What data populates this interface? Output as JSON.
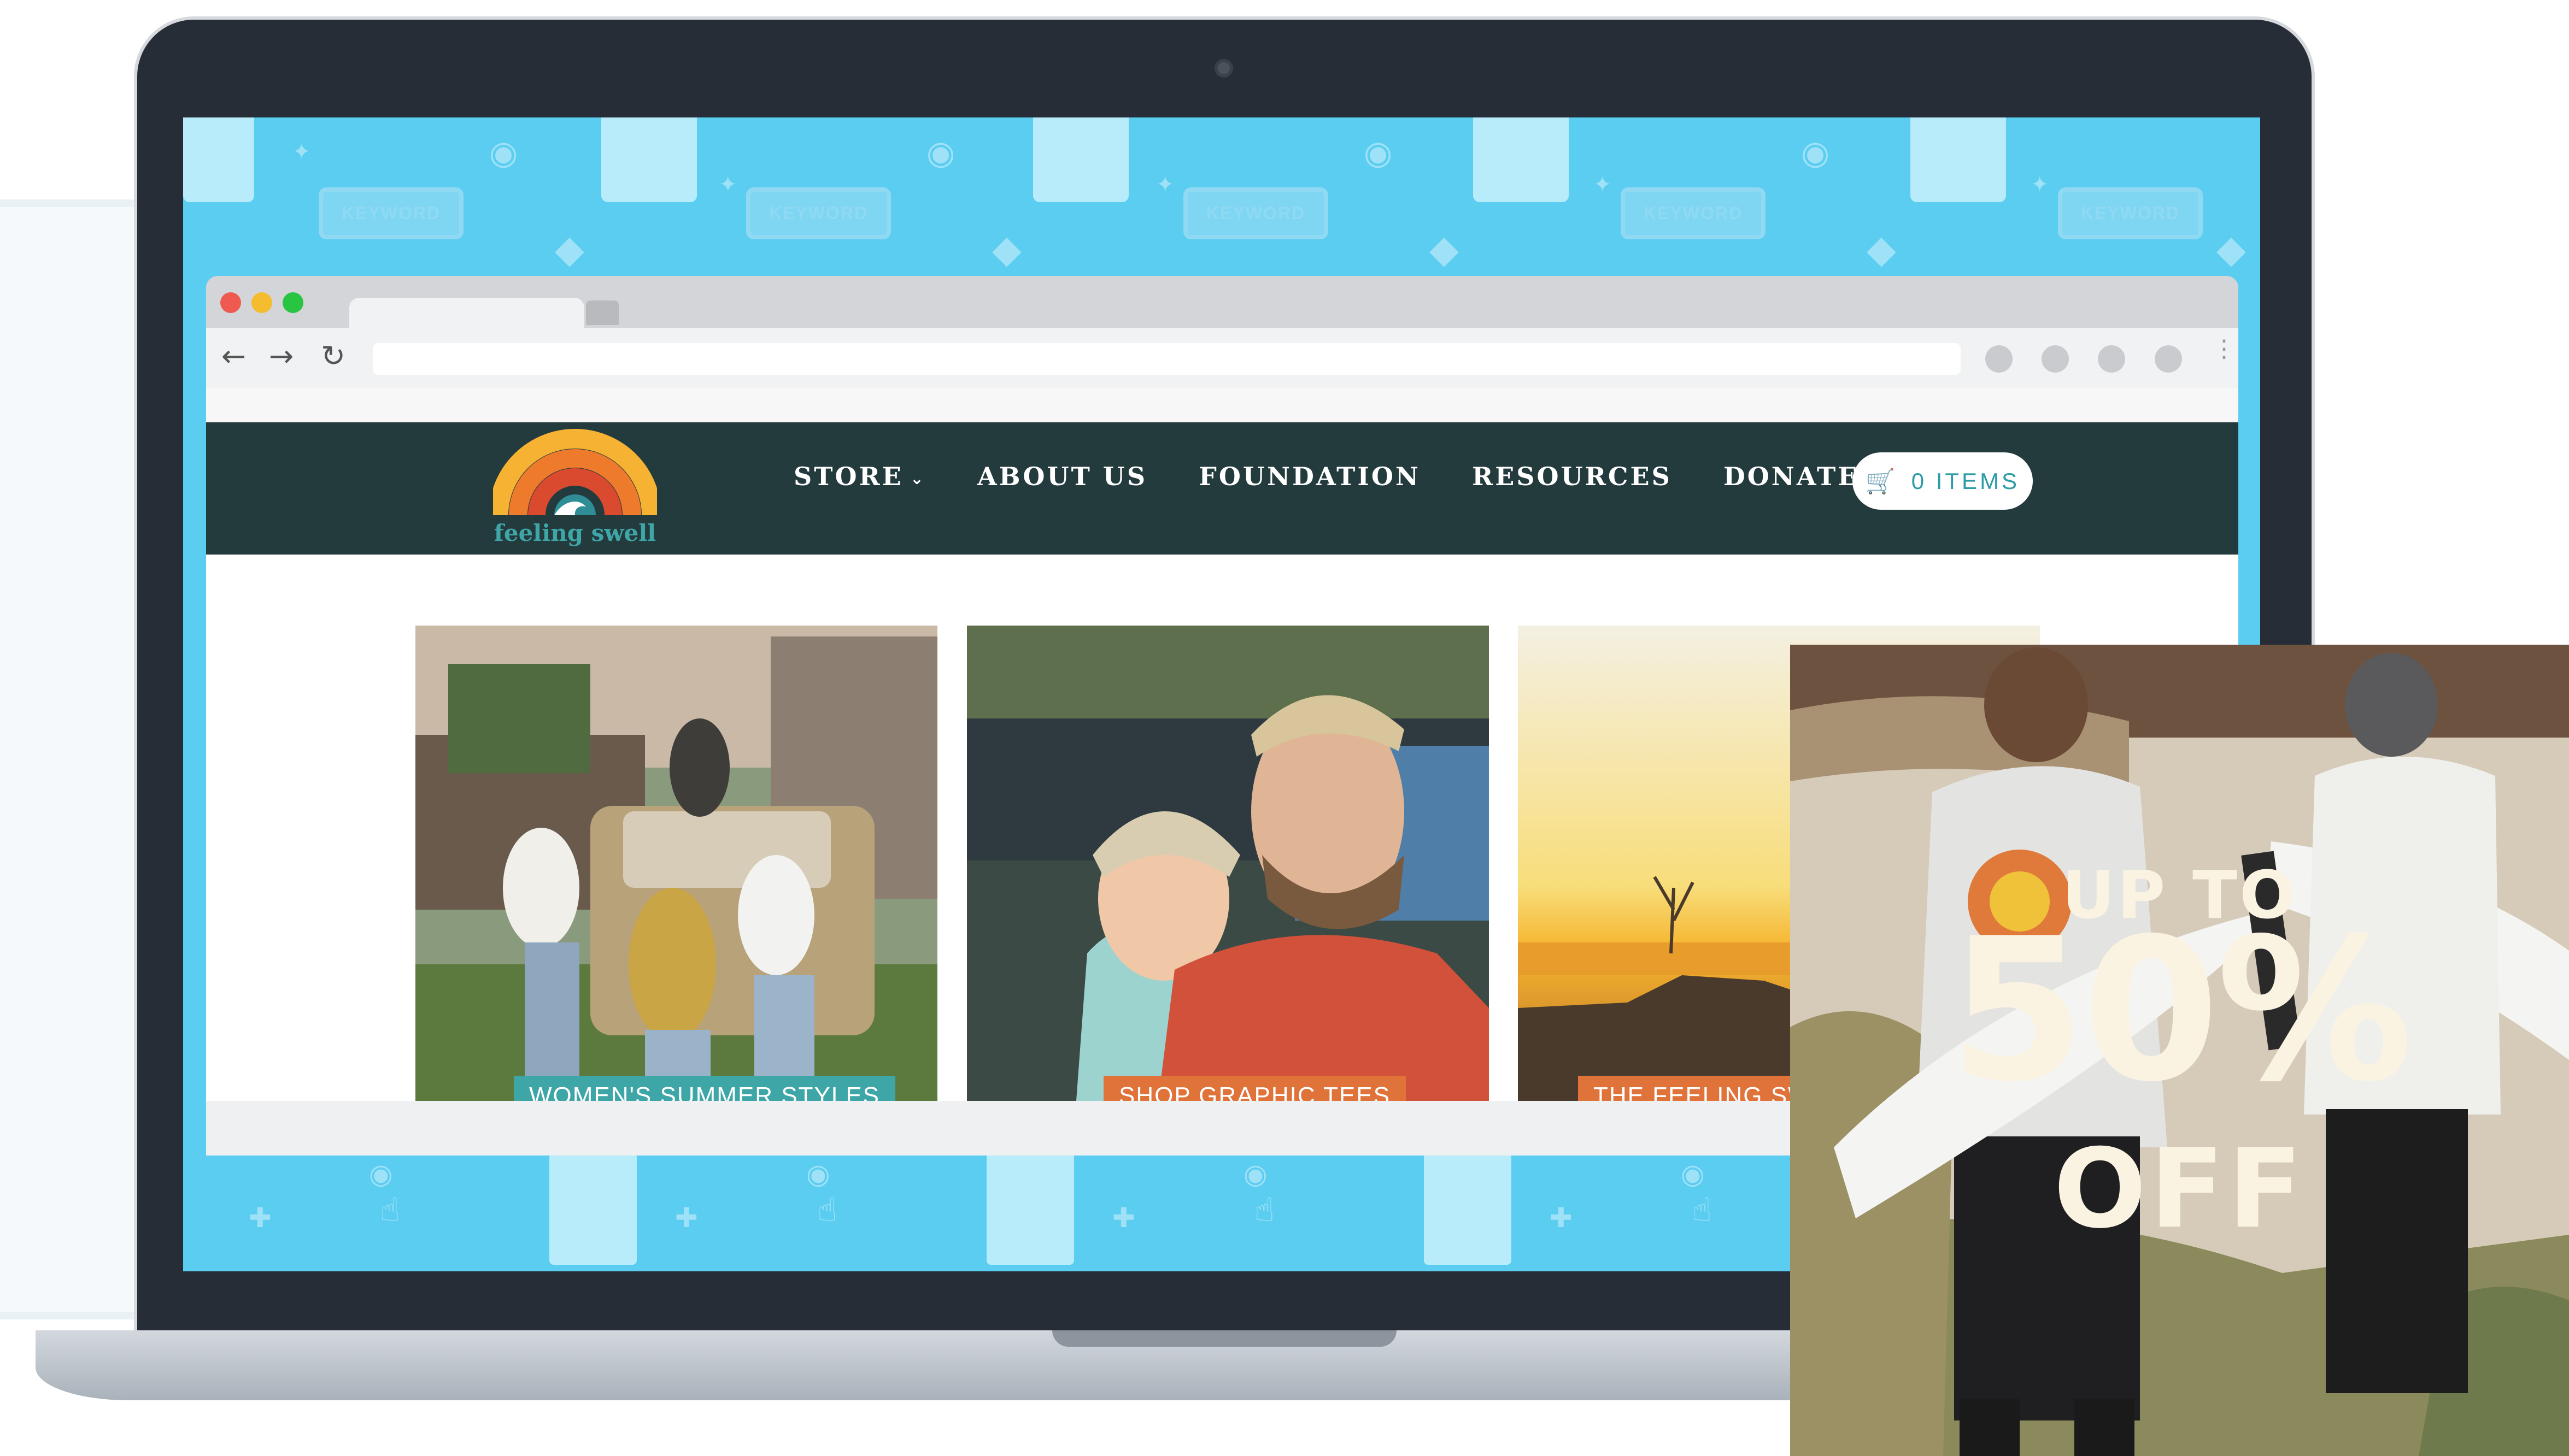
{
  "pattern": {
    "keyword_label": "KEYWORD"
  },
  "brand": {
    "name": "feeling swell"
  },
  "nav": {
    "items": [
      {
        "label": "STORE",
        "has_dropdown": true
      },
      {
        "label": "ABOUT US"
      },
      {
        "label": "FOUNDATION"
      },
      {
        "label": "RESOURCES"
      },
      {
        "label": "DONATE"
      }
    ]
  },
  "cart": {
    "label": "0 ITEMS"
  },
  "cards": [
    {
      "label": "WOMEN'S SUMMER STYLES",
      "label_color": "#3fa6a8"
    },
    {
      "label": "SHOP GRAPHIC TEES",
      "label_color": "#e0733a"
    },
    {
      "label": "THE FEELING SWELL",
      "label_color": "#e0733a"
    }
  ],
  "promo": {
    "line1": "UP TO",
    "line2": "50%",
    "line3": "OFF"
  },
  "colors": {
    "header_bg": "#243b3e",
    "screen_bg": "#5bcdf0",
    "accent_teal": "#2d9ca6",
    "accent_orange": "#e0733a"
  }
}
